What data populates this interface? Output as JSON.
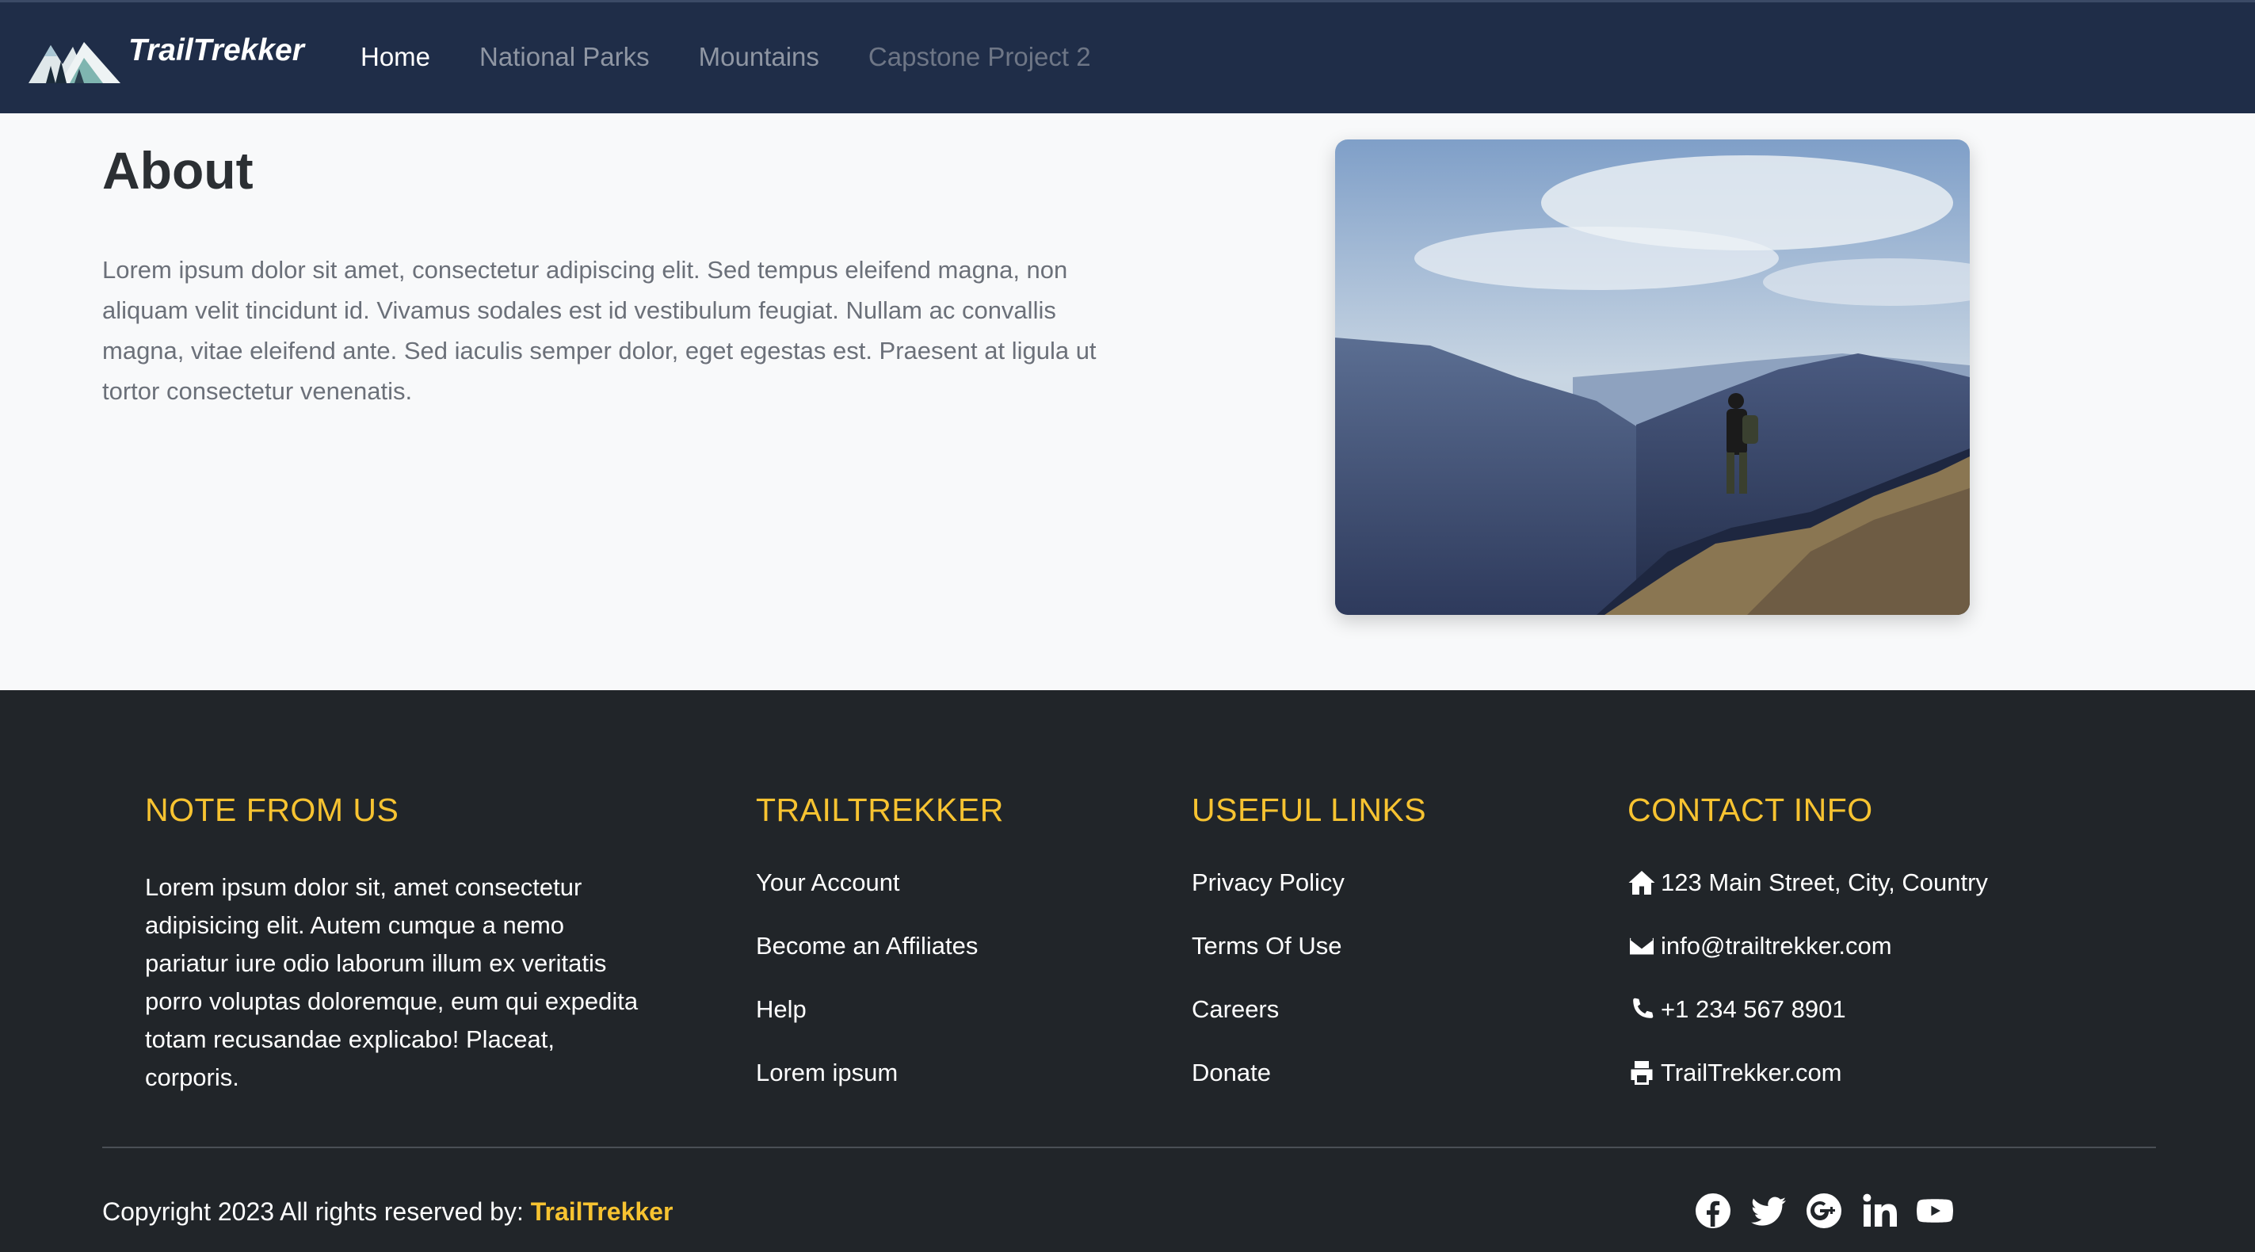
{
  "navbar": {
    "brand": "TrailTrekker",
    "links": [
      {
        "label": "Home",
        "active": true
      },
      {
        "label": "National Parks",
        "active": false
      },
      {
        "label": "Mountains",
        "active": false
      },
      {
        "label": "Capstone Project 2",
        "active": false
      }
    ]
  },
  "about": {
    "title": "About",
    "text": "Lorem ipsum dolor sit amet, consectetur adipiscing elit. Sed tempus eleifend magna, non aliquam velit tincidunt id. Vivamus sodales est id vestibulum feugiat. Nullam ac convallis magna, vitae eleifend ante. Sed iaculis semper dolor, eget egestas est. Praesent at ligula ut tortor consectetur venenatis."
  },
  "footer": {
    "note": {
      "heading": "NOTE FROM US",
      "text": "Lorem ipsum dolor sit, amet consectetur adipisicing elit. Autem cumque a nemo pariatur iure odio laborum illum ex veritatis porro voluptas doloremque, eum qui expedita totam recusandae explicabo! Placeat, corporis."
    },
    "trailtrekker": {
      "heading": "TRAILTREKKER",
      "links": [
        "Your Account",
        "Become an Affiliates",
        "Help",
        "Lorem ipsum"
      ]
    },
    "useful": {
      "heading": "USEFUL LINKS",
      "links": [
        "Privacy Policy",
        "Terms Of Use",
        "Careers",
        "Donate"
      ]
    },
    "contact": {
      "heading": "CONTACT INFO",
      "address": "123 Main Street, City, Country",
      "email": "info@trailtrekker.com",
      "phone": "+1 234 567 8901",
      "website": "TrailTrekker.com"
    },
    "copyright_prefix": "Copyright 2023 All rights reserved by: ",
    "copyright_brand": "TrailTrekker",
    "social": [
      "facebook-icon",
      "twitter-icon",
      "google-plus-icon",
      "linkedin-icon",
      "youtube-icon"
    ]
  },
  "colors": {
    "navbar_bg": "#1f2d48",
    "footer_bg": "#212529",
    "accent": "#f7c331"
  }
}
